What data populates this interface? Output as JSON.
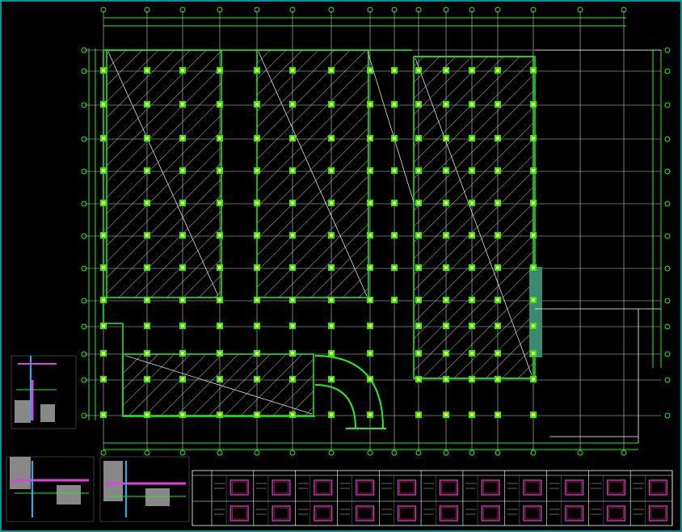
{
  "drawing": {
    "notes": [
      "",
      ""
    ],
    "side_label": ""
  },
  "colors": {
    "background": "#000000",
    "border": "#00c8c8",
    "grid": "#ffffff",
    "walls": "#22ee22",
    "columns": "#ffff33",
    "column_marker": "#22ee22",
    "bubble": "#22ee22",
    "dimension": "#22ee22",
    "hatch": "#cccccc",
    "accent": "#e040e0",
    "ramp_band": "#3a8a70"
  },
  "plan": {
    "axis_bubble_icon": "circle-icon",
    "column_icon": "square-icon",
    "hatched_slab_count": 4
  },
  "schedule": {
    "rows": 2,
    "columns": 11
  }
}
